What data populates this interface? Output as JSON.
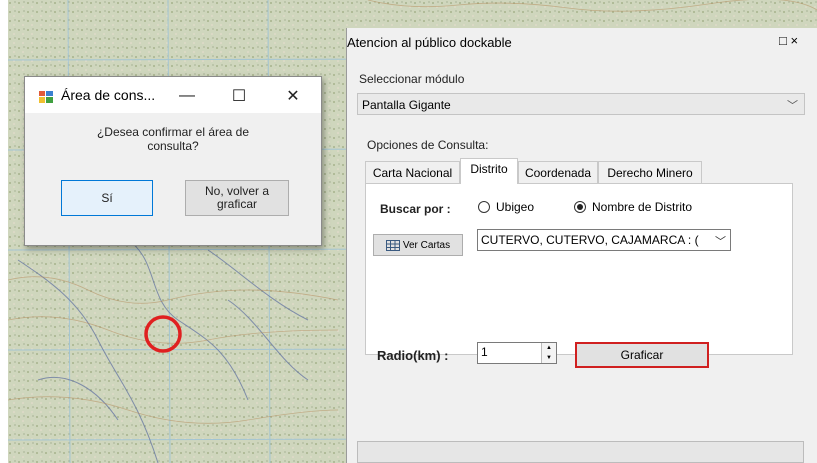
{
  "confirm_dialog": {
    "title": "Área de cons...",
    "minimize_glyph": "—",
    "maximize_glyph": "☐",
    "close_glyph": "✕",
    "message_line1": "¿Desea confirmar el área de",
    "message_line2": "consulta?",
    "yes_label": "Sí",
    "no_label_line1": "No, volver a",
    "no_label_line2": "graficar"
  },
  "panel": {
    "title": "Atencion al público dockable",
    "controls": "□ ×",
    "module_label": "Seleccionar módulo",
    "module_value": "Pantalla Gigante",
    "options_label": "Opciones de Consulta:",
    "tabs": [
      {
        "label": "Carta Nacional"
      },
      {
        "label": "Distrito"
      },
      {
        "label": "Coordenada"
      },
      {
        "label": "Derecho Minero"
      }
    ],
    "buscar_label": "Buscar por :",
    "radio_ubigeo": "Ubigeo",
    "radio_nombre": "Nombre de Distrito",
    "ver_cartas_label": "Ver Cartas",
    "district_value": "CUTERVO, CUTERVO, CAJAMARCA : (",
    "radio_km_label": "Radio(km) :",
    "radio_km_value": "1",
    "graficar_label": "Graficar"
  },
  "icons": {
    "app": "app-icon",
    "grid": "grid-icon",
    "dropdown": "chevron-down-icon"
  },
  "colors": {
    "map_base": "#c9d2b5",
    "highlight_circle": "#e02020",
    "accent": "#0078d7",
    "graficar_border": "#d02020"
  }
}
